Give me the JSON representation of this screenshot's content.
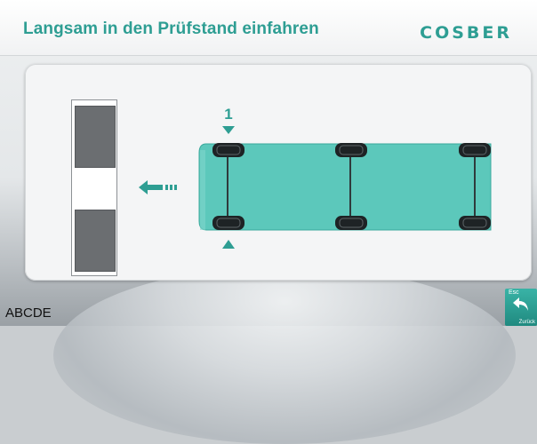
{
  "header": {
    "title": "Langsam in den Prüfstand einfahren",
    "brand": "COSBER"
  },
  "diagram": {
    "axle_number": "1",
    "direction_icon": "arrow-left-icon",
    "colors": {
      "vehicle_body": "#5cc8bb",
      "accent": "#2e9e93",
      "roller": "#6b6e71"
    }
  },
  "footer": {
    "code_label": "ABCDE"
  },
  "back_button": {
    "key_label": "Esc",
    "label": "Zurück",
    "icon": "back-arrow-icon"
  }
}
